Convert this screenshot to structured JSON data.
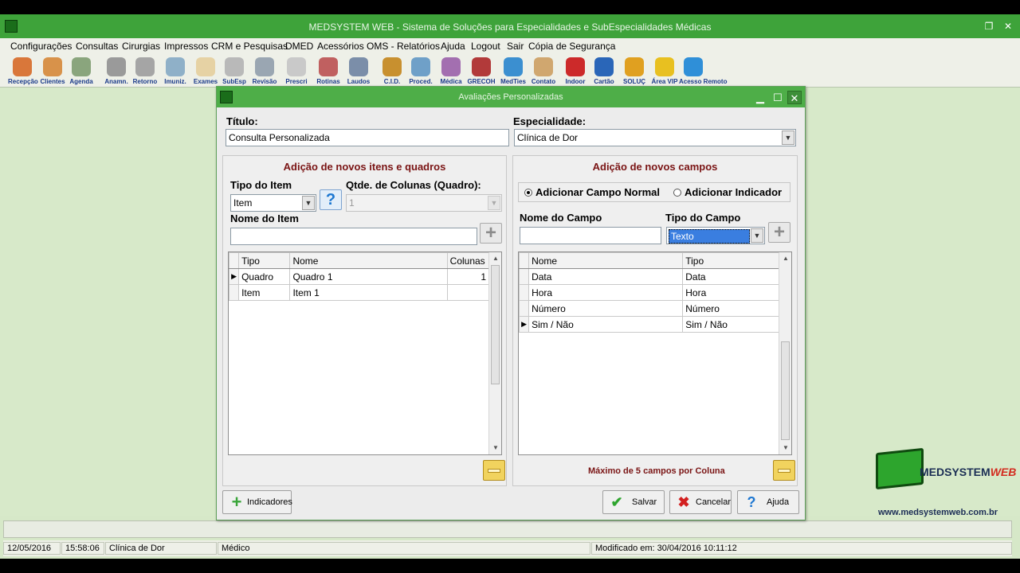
{
  "app": {
    "title": "MEDSYSTEM WEB - Sistema de Soluções para Especialidades e SubEspecialidades Médicas",
    "restore_glyph": "❐",
    "close_glyph": "✕"
  },
  "menu": [
    "Configurações",
    "Consultas",
    "Cirurgias",
    "Impressos",
    "CRM e Pesquisas",
    "DMED",
    "Acessórios",
    "OMS - Relatórios",
    "Ajuda",
    "Logout",
    "Sair",
    "Cópia de Segurança"
  ],
  "toolbar": [
    {
      "label": "Recepção",
      "icon": "reception-icon",
      "color": "#d9773a"
    },
    {
      "label": "Clientes",
      "icon": "clients-icon",
      "color": "#d8924a"
    },
    {
      "label": "Agenda",
      "icon": "agenda-icon",
      "color": "#8aa57d"
    },
    {
      "label": "Anamn.",
      "icon": "stethoscope-icon",
      "color": "#9a9a9a"
    },
    {
      "label": "Retorno",
      "icon": "return-icon",
      "color": "#a5a5a5"
    },
    {
      "label": "Imuniz.",
      "icon": "syringe-icon",
      "color": "#8fb0c8"
    },
    {
      "label": "Exames",
      "icon": "exams-icon",
      "color": "#e6d2a4"
    },
    {
      "label": "SubEsp",
      "icon": "subspecialty-icon",
      "color": "#b9b9b9"
    },
    {
      "label": "Revisão",
      "icon": "review-icon",
      "color": "#9aa6b2"
    },
    {
      "label": "Prescri",
      "icon": "prescription-icon",
      "color": "#c9c9c9"
    },
    {
      "label": "Rotinas",
      "icon": "routines-icon",
      "color": "#c06060"
    },
    {
      "label": "Laudos",
      "icon": "reports-icon",
      "color": "#7b8ea9"
    },
    {
      "label": "C.I.D.",
      "icon": "cid-book-icon",
      "color": "#c8902f"
    },
    {
      "label": "Proced.",
      "icon": "procedures-icon",
      "color": "#6fa0c8"
    },
    {
      "label": "Médica",
      "icon": "medical-icon",
      "color": "#a36fb0"
    },
    {
      "label": "GRECOH",
      "icon": "grecoh-icon",
      "color": "#b23a3a"
    },
    {
      "label": "MedTies",
      "icon": "globe-icon",
      "color": "#3b8fd0"
    },
    {
      "label": "Contato",
      "icon": "contact-icon",
      "color": "#d0a76f"
    },
    {
      "label": "Indoor",
      "icon": "indoor-icon",
      "color": "#cc2a2a"
    },
    {
      "label": "Cartão",
      "icon": "card-icon",
      "color": "#2a66b8"
    },
    {
      "label": "SOLUÇ",
      "icon": "solutions-icon",
      "color": "#e0a020"
    },
    {
      "label": "Área VIP",
      "icon": "crown-icon",
      "color": "#e8c020"
    },
    {
      "label": "Acesso Remoto",
      "icon": "remote-access-icon",
      "color": "#2f8fd8"
    }
  ],
  "dialog": {
    "title": "Avaliações Personalizadas",
    "titulo_label": "Título:",
    "titulo_value": "Consulta Personalizada",
    "especialidade_label": "Especialidade:",
    "especialidade_value": "Clínica de Dor",
    "left": {
      "title": "Adição de novos itens e quadros",
      "tipo_item_label": "Tipo do Item",
      "tipo_item_value": "Item",
      "qtde_label": "Qtde. de Colunas (Quadro):",
      "qtde_value": "1",
      "nome_item_label": "Nome do Item",
      "nome_item_value": "",
      "columns": [
        "Tipo",
        "Nome",
        "Colunas"
      ],
      "rows": [
        {
          "tipo": "Quadro",
          "nome": "Quadro 1",
          "colunas": "1",
          "current": true
        },
        {
          "tipo": "Item",
          "nome": "Item 1",
          "colunas": "",
          "current": false
        }
      ]
    },
    "right": {
      "title": "Adição de novos campos",
      "radio_normal": "Adicionar Campo Normal",
      "radio_indicador": "Adicionar Indicador",
      "nome_campo_label": "Nome do Campo",
      "nome_campo_value": "",
      "tipo_campo_label": "Tipo do Campo",
      "tipo_campo_value": "Texto",
      "columns": [
        "Nome",
        "Tipo"
      ],
      "rows": [
        {
          "nome": "Data",
          "tipo": "Data",
          "current": false
        },
        {
          "nome": "Hora",
          "tipo": "Hora",
          "current": false
        },
        {
          "nome": "Número",
          "tipo": "Número",
          "current": false
        },
        {
          "nome": "Sim / Não",
          "tipo": "Sim / Não",
          "current": true
        }
      ],
      "max_note": "Máximo de 5 campos por Coluna"
    },
    "buttons": {
      "indicadores": "Indicadores",
      "salvar": "Salvar",
      "cancelar": "Cancelar",
      "ajuda": "Ajuda"
    }
  },
  "status": {
    "date": "12/05/2016",
    "time": "15:58:06",
    "specialty": "Clínica de Dor",
    "role": "Médico",
    "modified": "Modificado em: 30/04/2016 10:11:12"
  },
  "logo": {
    "brand_a": "MEDSYSTEM",
    "brand_b": "WEB",
    "url": "www.medsystemweb.com.br"
  }
}
